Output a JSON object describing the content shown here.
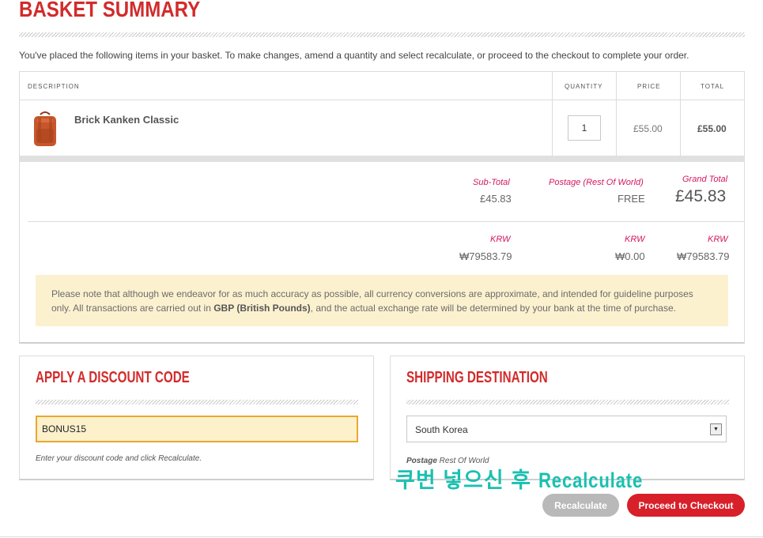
{
  "page": {
    "title": "BASKET SUMMARY",
    "intro": "You've placed the following items in your basket. To make changes, amend a quantity and select recalculate, or proceed to the checkout to complete your order."
  },
  "table": {
    "headers": {
      "description": "DESCRIPTION",
      "quantity": "QUANTITY",
      "price": "PRICE",
      "total": "TOTAL"
    },
    "items": [
      {
        "name": "Brick Kanken Classic",
        "quantity": "1",
        "price": "£55.00",
        "total": "£55.00"
      }
    ]
  },
  "totals": {
    "subtotal_label": "Sub-Total",
    "subtotal_value": "£45.83",
    "postage_label": "Postage (Rest Of World)",
    "postage_value": "FREE",
    "grand_label": "Grand Total",
    "grand_value": "£45.83",
    "currency_label": "KRW",
    "subtotal_krw": "₩79583.79",
    "postage_krw": "₩0.00",
    "grand_krw": "₩79583.79"
  },
  "notice": {
    "text_before": "Please note that although we endeavor for as much accuracy as possible, all currency conversions are approximate, and intended for guideline purposes only. All transactions are carried out in ",
    "bold": "GBP (British Pounds)",
    "text_after": ", and the actual exchange rate will be determined by your bank at the time of purchase."
  },
  "discount": {
    "title": "APPLY A DISCOUNT CODE",
    "value": "BONUS15",
    "help": "Enter your discount code and click Recalculate."
  },
  "shipping": {
    "title": "SHIPPING DESTINATION",
    "selected": "South Korea",
    "postage_bold": "Postage",
    "postage_rest": " Rest Of World"
  },
  "overlay": {
    "korean": "쿠번 넣으신 후 ",
    "latin": "Recalculate"
  },
  "buttons": {
    "recalculate": "Recalculate",
    "checkout": "Proceed to Checkout"
  },
  "colors": {
    "brand_red": "#d22b2b",
    "label_pink": "#d4165f",
    "notice_bg": "#fcf1cf",
    "overlay_teal": "#1ac0b0",
    "backpack_orange": "#c8562c"
  },
  "icons": {
    "product": "backpack-image",
    "select": "dropdown-arrow-icon"
  }
}
